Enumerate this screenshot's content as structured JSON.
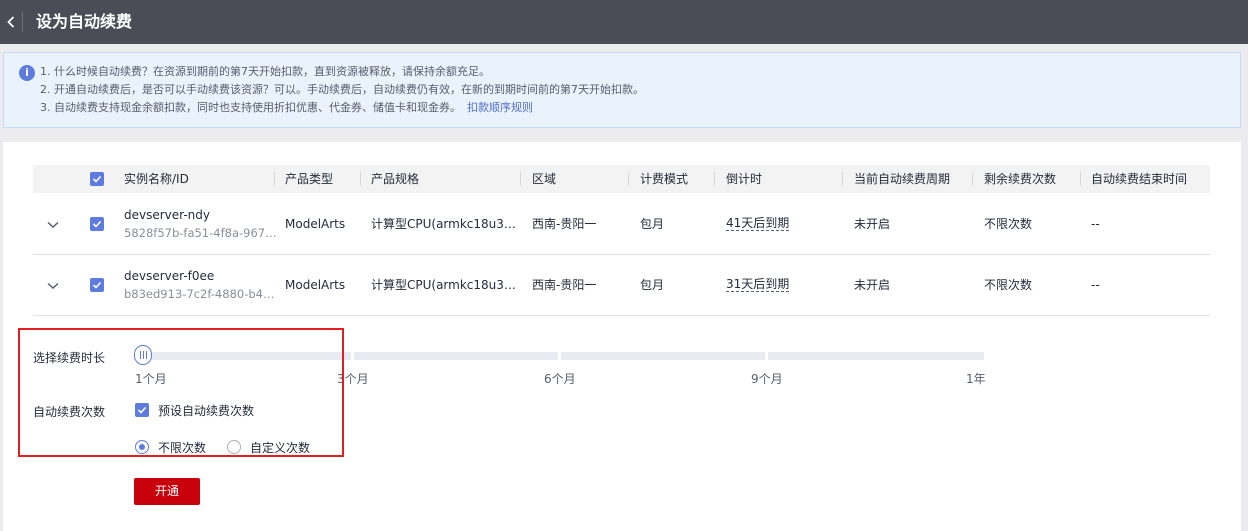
{
  "header": {
    "title": "设为自动续费"
  },
  "notice": {
    "line1": "1. 什么时候自动续费？在资源到期前的第7天开始扣款，直到资源被释放，请保持余额充足。",
    "line2": "2. 开通自动续费后，是否可以手动续费该资源？可以。手动续费后，自动续费仍有效，在新的到期时间前的第7天开始扣款。",
    "line3": "3. 自动续费支持现金余额扣款，同时也支持使用折扣优惠、代金券、储值卡和现金券。",
    "link": "扣款顺序规则"
  },
  "table": {
    "columns": [
      "实例名称/ID",
      "产品类型",
      "产品规格",
      "区域",
      "计费模式",
      "倒计时",
      "当前自动续费周期",
      "剩余续费次数",
      "自动续费结束时间"
    ],
    "rows": [
      {
        "name": "devserver-ndy",
        "id": "5828f57b-fa51-4f8a-967…",
        "type": "ModelArts",
        "spec": "计算型CPU(armkc18u3…",
        "region": "西南-贵阳一",
        "billing": "包月",
        "countdown": "41天后到期",
        "period": "未开启",
        "remaining": "不限次数",
        "end": "--"
      },
      {
        "name": "devserver-f0ee",
        "id": "b83ed913-7c2f-4880-b4…",
        "type": "ModelArts",
        "spec": "计算型CPU(armkc18u3…",
        "region": "西南-贵阳一",
        "billing": "包月",
        "countdown": "31天后到期",
        "period": "未开启",
        "remaining": "不限次数",
        "end": "--"
      }
    ]
  },
  "form": {
    "duration_label": "选择续费时长",
    "duration_ticks": [
      "1个月",
      "3个月",
      "6个月",
      "9个月",
      "1年"
    ],
    "duration_selected": "1个月",
    "count_label": "自动续费次数",
    "preset_checkbox_label": "预设自动续费次数",
    "radio_unlimited": "不限次数",
    "radio_custom": "自定义次数",
    "submit": "开通"
  },
  "colors": {
    "accent": "#5e7ce0",
    "submit": "#c7000b",
    "highlight": "#e02020",
    "topbar": "#4a4d56"
  }
}
